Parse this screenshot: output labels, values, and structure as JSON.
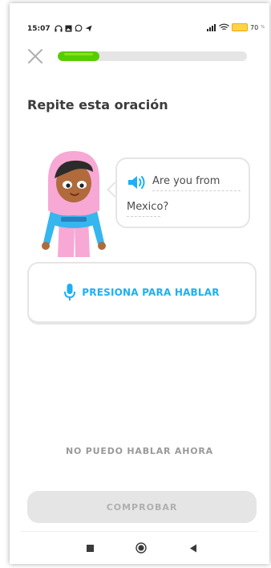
{
  "status_bar": {
    "time": "15:07",
    "battery": "70",
    "battery_unit": "%",
    "icons": [
      "headset-icon",
      "image-icon",
      "whatsapp-icon",
      "send-icon",
      "signal-icon",
      "wifi-icon",
      "battery-icon"
    ]
  },
  "lesson": {
    "progress": 0.22,
    "title": "Repite esta oración",
    "sentence_line1": "Are you from",
    "sentence_line2": "Mexico?",
    "speak_label": "PRESIONA PARA HABLAR",
    "cant_speak_label": "NO PUEDO HABLAR AHORA",
    "check_label": "COMPROBAR"
  },
  "colors": {
    "accent_green": "#58cc02",
    "accent_blue": "#1cb0f6",
    "disabled": "#e5e5e5"
  }
}
